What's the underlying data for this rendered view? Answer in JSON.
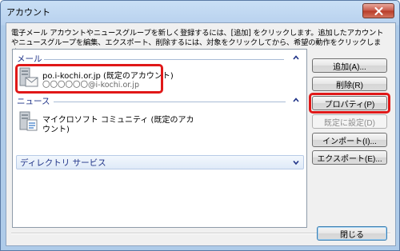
{
  "window": {
    "title": "アカウント"
  },
  "description": "電子メール アカウントやニュースグループを新しく登録するには、[追加] をクリックします。追加したアカウントやニュースグループを編集、エクスポート、削除するには、対象をクリックしてから、希望の動作をクリックします。",
  "groups": {
    "mail": {
      "label": "メール",
      "accounts": [
        {
          "name": "po.i-kochi.or.jp (既定のアカウント)",
          "address": "〇〇〇〇〇〇@i-kochi.or.jp"
        }
      ]
    },
    "news": {
      "label": "ニュース",
      "accounts": [
        {
          "name_line1": "マイクロソフト コミュニティ (既定のアカ",
          "name_line2": "ウント)"
        }
      ]
    },
    "directory": {
      "label": "ディレクトリ サービス"
    }
  },
  "buttons": {
    "add": "追加(A)...",
    "remove": "削除(R)",
    "properties": "プロパティ(P)",
    "set_default": "既定に設定(D)",
    "import": "インポート(I)...",
    "export": "エクスポート(E)...",
    "close": "閉じる"
  },
  "colors": {
    "highlight": "#e01818",
    "group_label": "#1e3287"
  },
  "icons": {
    "close": "close-icon",
    "mail_account": "mail-account-icon",
    "news_account": "news-account-icon",
    "collapse": "chevron-up-icon",
    "expand": "chevron-down-icon"
  }
}
